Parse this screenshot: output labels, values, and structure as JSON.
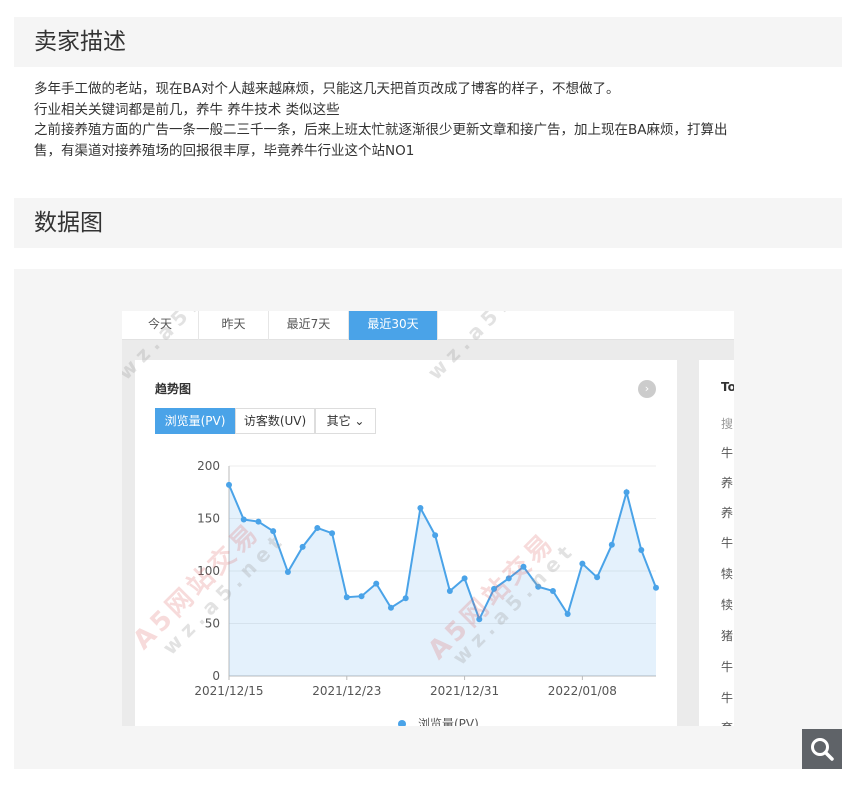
{
  "sections": {
    "seller_title": "卖家描述",
    "data_title": "数据图"
  },
  "description": {
    "lines": [
      "多年手工做的老站，现在BA对个人越来越麻烦，只能这几天把首页改成了博客的样子，不想做了。",
      "行业相关关键词都是前几，养牛 养牛技术 类似这些",
      "之前接养殖方面的广告一条一般二三千一条，后来上班太忙就逐渐很少更新文章和接广告，加上现在BA麻烦，打算出",
      "售，有渠道对接养殖场的回报很丰厚，毕竟养牛行业这个站NO1"
    ]
  },
  "screenshot": {
    "tabs": [
      "今天",
      "昨天",
      "最近7天",
      "最近30天"
    ],
    "active_tab": "最近30天",
    "card_title": "趋势图",
    "arrow": "›",
    "subtabs": [
      "浏览量(PV)",
      "访客数(UV)",
      "其它 ⌄"
    ],
    "legend_label": "浏览量(PV)",
    "side_title": "To",
    "side_header": "搜",
    "side_rows": [
      "牛",
      "养",
      "养",
      "牛",
      "犊",
      "犊",
      "猪",
      "牛",
      "牛",
      "育"
    ],
    "watermark_logo": "A5网站交易",
    "watermark_url": "wz.a5.net"
  },
  "chart_data": {
    "type": "area",
    "title": "",
    "xlabel": "",
    "ylabel": "",
    "ylim": [
      0,
      200
    ],
    "yticks": [
      "0",
      "50",
      "100",
      "150",
      "200"
    ],
    "xticks": [
      "2021/12/15",
      "2021/12/23",
      "2021/12/31",
      "2022/01/08"
    ],
    "color": "#4aa3e8",
    "grid": true,
    "series": [
      {
        "name": "浏览量(PV)",
        "values": [
          182,
          149,
          147,
          138,
          99,
          123,
          141,
          136,
          75,
          76,
          88,
          65,
          74,
          160,
          134,
          81,
          93,
          54,
          83,
          93,
          104,
          85,
          81,
          59,
          107,
          94,
          125,
          175,
          120,
          84
        ]
      }
    ]
  },
  "icons": {
    "zoom": "search-icon"
  }
}
